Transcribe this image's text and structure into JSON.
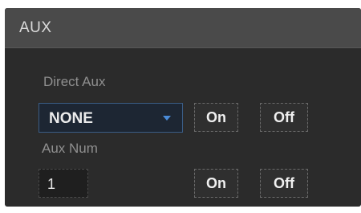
{
  "header": {
    "title": "AUX"
  },
  "direct_aux": {
    "label": "Direct Aux",
    "selected": "NONE",
    "on_label": "On",
    "off_label": "Off"
  },
  "aux_num": {
    "label": "Aux Num",
    "value": "1",
    "on_label": "On",
    "off_label": "Off"
  },
  "colors": {
    "panel_bg": "#2b2b2b",
    "header_bg": "#4a4a4a",
    "accent": "#4a8bd8",
    "text": "#ececec",
    "label_text": "#8f8f8f"
  },
  "icons": {
    "dropdown": "chevron-down-icon"
  }
}
